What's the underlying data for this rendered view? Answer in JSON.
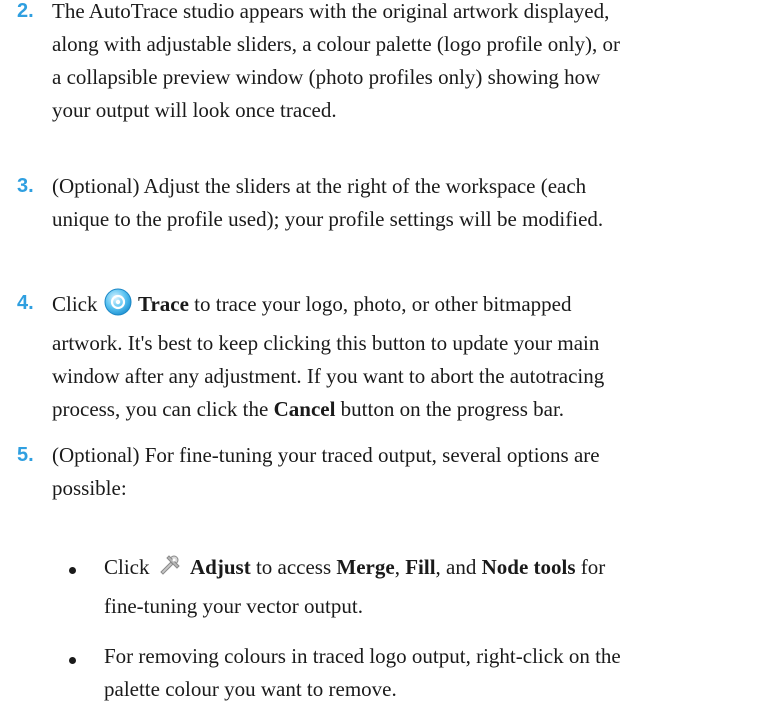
{
  "steps": [
    {
      "number": "2.",
      "lines": [
        "The AutoTrace studio appears with the original artwork displayed,",
        "along with adjustable sliders, a colour palette (logo profile only), or",
        "a collapsible preview window (photo profiles only) showing how",
        "your output will look once traced."
      ]
    },
    {
      "number": "3.",
      "lines": [
        "(Optional) Adjust the sliders at the right of the workspace (each",
        "unique to the profile used); your profile settings will be modified."
      ]
    },
    {
      "number": "4.",
      "line1_pre": "Click",
      "line1_bold": "Trace",
      "line1_post": "to trace your logo, photo, or other bitmapped",
      "line2": "artwork. It's best to keep clicking this button to update your main",
      "line3": "window after any adjustment. If you want to abort the autotracing",
      "line4_pre": "process, you can click the",
      "line4_bold": "Cancel",
      "line4_post": "button on the progress bar.",
      "icon": "trace-icon"
    },
    {
      "number": "5.",
      "lines": [
        "(Optional) For fine-tuning your traced output, several options are",
        "possible:"
      ]
    }
  ],
  "bullets": [
    {
      "pre": "Click",
      "b1": "Adjust",
      "mid1": "to access",
      "b2": "Merge",
      "mid2": ",",
      "b3": "Fill",
      "mid3": ", and",
      "b4": "Node tools",
      "post": "for",
      "line2": "fine-tuning your vector output.",
      "icon": "adjust-wrench-icon"
    },
    {
      "line1": "For removing colours in traced logo output, right-click on the",
      "line2": "palette colour you want to remove."
    }
  ],
  "colors": {
    "step_number": "#2f9fe0",
    "text": "#1a1a1a"
  }
}
